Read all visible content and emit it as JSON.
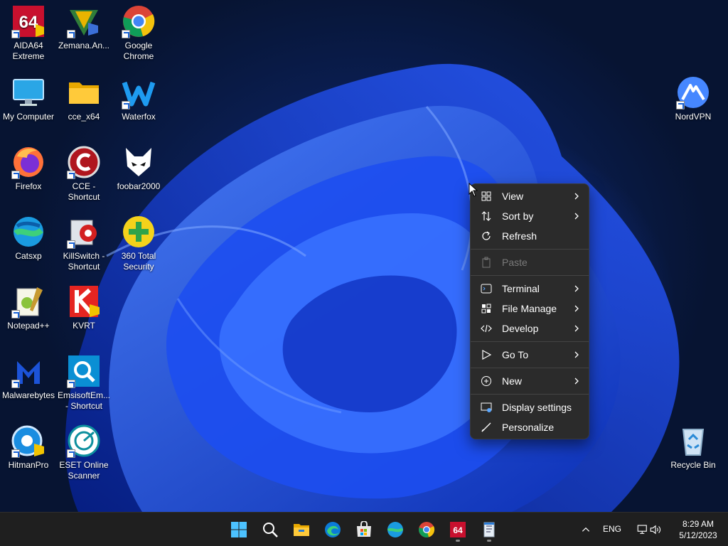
{
  "desktop_icons": [
    {
      "label": "AIDA64\nExtreme",
      "icon": "aida64-icon"
    },
    {
      "label": "Zemana.An...",
      "icon": "zemana-icon"
    },
    {
      "label": "Google\nChrome",
      "icon": "chrome-icon"
    },
    {
      "label": "My Computer",
      "icon": "monitor-icon"
    },
    {
      "label": "cce_x64",
      "icon": "folder-icon"
    },
    {
      "label": "Waterfox",
      "icon": "waterfox-icon"
    },
    {
      "label": "NordVPN",
      "icon": "nordvpn-icon"
    },
    {
      "label": "Firefox",
      "icon": "firefox-icon"
    },
    {
      "label": "CCE -\nShortcut",
      "icon": "cce-icon"
    },
    {
      "label": "foobar2000",
      "icon": "foobar-icon"
    },
    {
      "label": "Catsxp",
      "icon": "catsxp-icon"
    },
    {
      "label": "KillSwitch -\nShortcut",
      "icon": "killswitch-icon"
    },
    {
      "label": "360 Total\nSecurity",
      "icon": "360-security-icon"
    },
    {
      "label": "Notepad++",
      "icon": "notepadpp-icon"
    },
    {
      "label": "KVRT",
      "icon": "kvrt-icon"
    },
    {
      "label": "Malwarebytes",
      "icon": "malwarebytes-icon"
    },
    {
      "label": "EmsisoftEm...\n- Shortcut",
      "icon": "emsisoft-icon"
    },
    {
      "label": "HitmanPro",
      "icon": "hitmanpro-icon"
    },
    {
      "label": "ESET Online\nScanner",
      "icon": "eset-icon"
    },
    {
      "label": "Recycle Bin",
      "icon": "recycle-bin-icon"
    }
  ],
  "context_menu": {
    "items": [
      {
        "label": "View",
        "icon": "grid-icon",
        "submenu": true
      },
      {
        "label": "Sort by",
        "icon": "sort-icon",
        "submenu": true
      },
      {
        "label": "Refresh",
        "icon": "refresh-icon",
        "submenu": false
      },
      {
        "label": "Paste",
        "icon": "paste-icon",
        "submenu": false,
        "disabled": true
      },
      {
        "label": "Terminal",
        "icon": "terminal-icon",
        "submenu": true
      },
      {
        "label": "File Manage",
        "icon": "apps-icon",
        "submenu": true
      },
      {
        "label": "Develop",
        "icon": "code-icon",
        "submenu": true
      },
      {
        "label": "Go To",
        "icon": "play-outline-icon",
        "submenu": true
      },
      {
        "label": "New",
        "icon": "plus-circle-icon",
        "submenu": true
      },
      {
        "label": "Display settings",
        "icon": "display-icon",
        "submenu": false
      },
      {
        "label": "Personalize",
        "icon": "brush-icon",
        "submenu": false
      }
    ]
  },
  "taskbar": {
    "apps": [
      "start-icon",
      "search-icon",
      "file-explorer-icon",
      "edge-icon",
      "store-icon",
      "catsxp-icon",
      "chrome-icon",
      "aida64-icon",
      "notepad-icon"
    ],
    "language": "ENG",
    "time": "8:29 AM",
    "date": "5/12/2023"
  },
  "colors": {
    "accent": "#1a63d6",
    "menu_bg": "#2b2b2b",
    "taskbar_bg": "#1f1f1f"
  }
}
